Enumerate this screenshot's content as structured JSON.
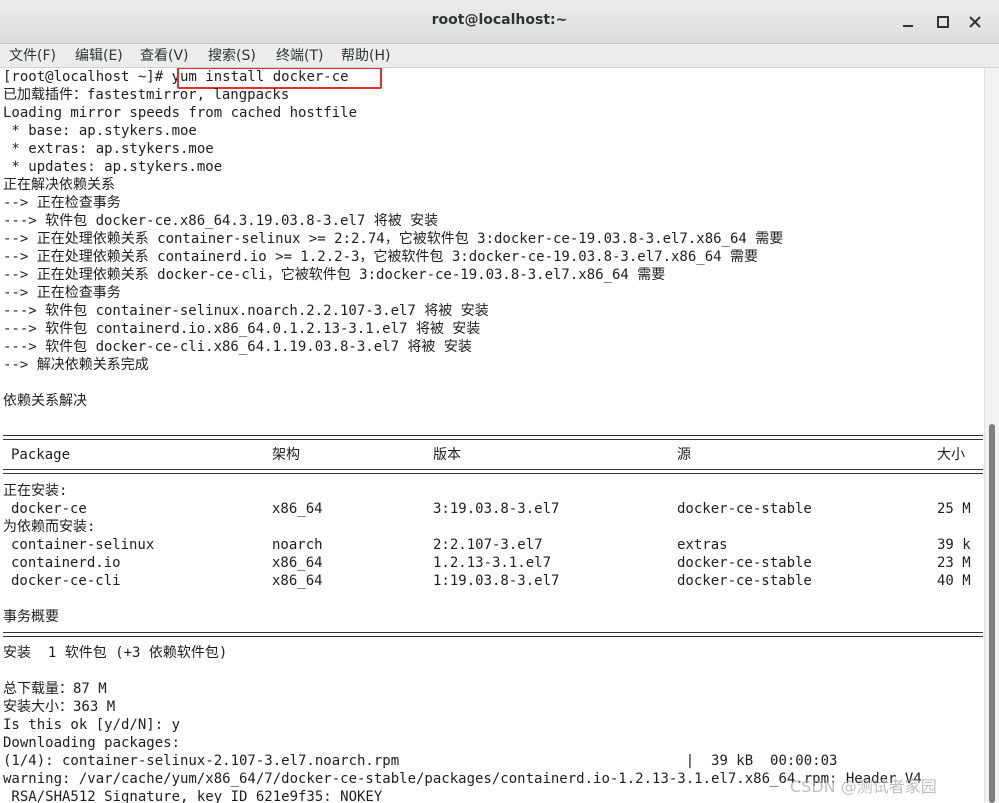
{
  "window": {
    "title": "root@localhost:~",
    "minimize_icon": "minimize-icon",
    "maximize_icon": "maximize-icon",
    "close_icon": "close-icon"
  },
  "menu": [
    "文件(F)",
    "编辑(E)",
    "查看(V)",
    "搜索(S)",
    "终端(T)",
    "帮助(H)"
  ],
  "terminal": {
    "prompt": "[root@localhost ~]# ",
    "command": "yum install docker-ce",
    "lines_top": [
      "已加载插件：fastestmirror, langpacks",
      "Loading mirror speeds from cached hostfile",
      " * base: ap.stykers.moe",
      " * extras: ap.stykers.moe",
      " * updates: ap.stykers.moe",
      "正在解决依赖关系",
      "--> 正在检查事务",
      "---> 软件包 docker-ce.x86_64.3.19.03.8-3.el7 将被 安装",
      "--> 正在处理依赖关系 container-selinux >= 2:2.74，它被软件包 3:docker-ce-19.03.8-3.el7.x86_64 需要",
      "--> 正在处理依赖关系 containerd.io >= 1.2.2-3，它被软件包 3:docker-ce-19.03.8-3.el7.x86_64 需要",
      "--> 正在处理依赖关系 docker-ce-cli，它被软件包 3:docker-ce-19.03.8-3.el7.x86_64 需要",
      "--> 正在检查事务",
      "---> 软件包 container-selinux.noarch.2.2.107-3.el7 将被 安装",
      "---> 软件包 containerd.io.x86_64.0.1.2.13-3.1.el7 将被 安装",
      "---> 软件包 docker-ce-cli.x86_64.1.19.03.8-3.el7 将被 安装",
      "--> 解决依赖关系完成",
      "",
      "依赖关系解决"
    ],
    "table_headers": [
      "Package",
      "架构",
      "版本",
      "源",
      "大小"
    ],
    "installing_label": "正在安装:",
    "dependency_label": "为依赖而安装:",
    "packages": [
      [
        "docker-ce",
        "x86_64",
        "3:19.03.8-3.el7",
        "docker-ce-stable",
        "25 M"
      ],
      [
        "container-selinux",
        "noarch",
        "2:2.107-3.el7",
        "extras",
        "39 k"
      ],
      [
        "containerd.io",
        "x86_64",
        "1.2.13-3.1.el7",
        "docker-ce-stable",
        "23 M"
      ],
      [
        "docker-ce-cli",
        "x86_64",
        "1:19.03.8-3.el7",
        "docker-ce-stable",
        "40 M"
      ]
    ],
    "summary_title": "事务概要",
    "install_summary": "安装  1 软件包 (+3 依赖软件包)",
    "lines_bottom": [
      "总下载量：87 M",
      "安装大小：363 M",
      "Is this ok [y/d/N]: y",
      "Downloading packages:",
      "(1/4): container-selinux-2.107-3.el7.noarch.rpm                                  |  39 kB  00:00:03",
      "warning: /var/cache/yum/x86_64/7/docker-ce-stable/packages/containerd.io-1.2.13-3.1.el7.x86_64.rpm: Header V4",
      " RSA/SHA512 Signature, key ID 621e9f35: NOKEY"
    ]
  },
  "watermark": "CSDN @测试者家园",
  "colors": {
    "highlight_box": "#e0302c",
    "text": "#1e1e1e",
    "titlebar": "#e4e4e4"
  }
}
